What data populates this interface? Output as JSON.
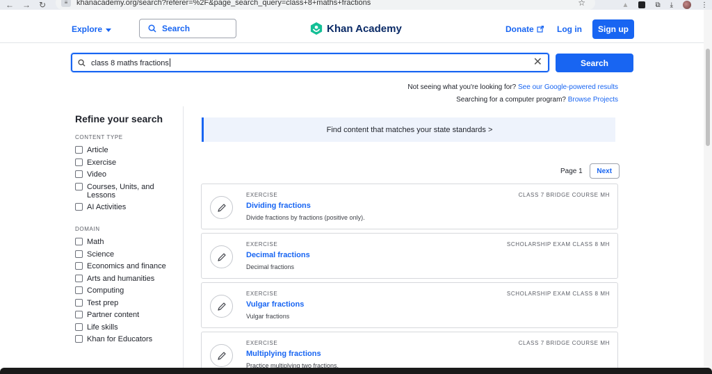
{
  "browser": {
    "url": "khanacademy.org/search?referer=%2F&page_search_query=class+8+maths+fractions"
  },
  "header": {
    "explore_label": "Explore",
    "search_label": "Search",
    "logo_text": "Khan Academy",
    "donate_label": "Donate",
    "login_label": "Log in",
    "signup_label": "Sign up",
    "brand_color": "#1865f2",
    "logo_color": "#14bf96"
  },
  "search": {
    "query": "class 8 maths fractions",
    "button_label": "Search",
    "not_seeing_text": "Not seeing what you're looking for?",
    "google_link": "See our Google-powered results",
    "program_text": "Searching for a computer program?",
    "projects_link": "Browse Projects"
  },
  "sidebar": {
    "title": "Refine your search",
    "content_type_heading": "CONTENT TYPE",
    "content_types": [
      "Article",
      "Exercise",
      "Video",
      "Courses, Units, and Lessons",
      "AI Activities"
    ],
    "domain_heading": "DOMAIN",
    "domains": [
      "Math",
      "Science",
      "Economics and finance",
      "Arts and humanities",
      "Computing",
      "Test prep",
      "Partner content",
      "Life skills",
      "Khan for Educators"
    ]
  },
  "main": {
    "banner_text": "Find content that matches your state standards >",
    "page_label": "Page 1",
    "next_label": "Next",
    "results": [
      {
        "type": "EXERCISE",
        "course": "CLASS 7 BRIDGE COURSE MH",
        "title": "Dividing fractions",
        "desc": "Divide fractions by fractions (positive only).",
        "icon": "pencil-icon"
      },
      {
        "type": "EXERCISE",
        "course": "SCHOLARSHIP EXAM CLASS 8 MH",
        "title": "Decimal fractions",
        "desc": "Decimal fractions",
        "icon": "pencil-icon"
      },
      {
        "type": "EXERCISE",
        "course": "SCHOLARSHIP EXAM CLASS 8 MH",
        "title": "Vulgar fractions",
        "desc": "Vulgar fractions",
        "icon": "pencil-icon"
      },
      {
        "type": "EXERCISE",
        "course": "CLASS 7 BRIDGE COURSE MH",
        "title": "Multiplying fractions",
        "desc": "Practice multiplying two fractions.",
        "icon": "pencil-icon"
      }
    ]
  }
}
